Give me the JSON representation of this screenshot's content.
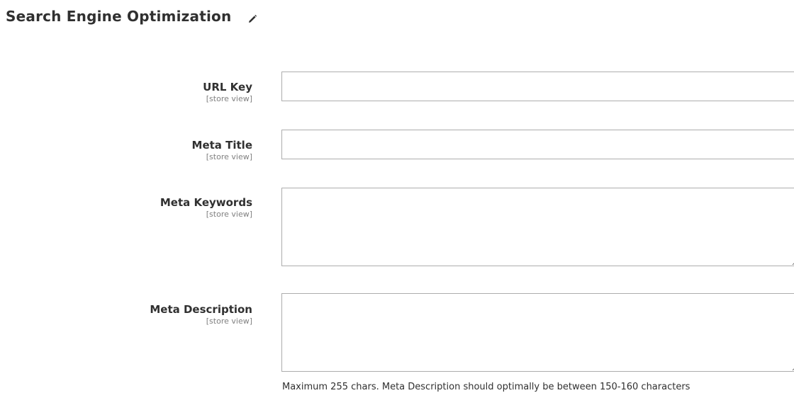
{
  "section": {
    "title": "Search Engine Optimization",
    "edit_icon": "pencil-icon"
  },
  "fields": {
    "url_key": {
      "label": "URL Key",
      "scope": "[store view]",
      "value": ""
    },
    "meta_title": {
      "label": "Meta Title",
      "scope": "[store view]",
      "value": ""
    },
    "meta_keywords": {
      "label": "Meta Keywords",
      "scope": "[store view]",
      "value": ""
    },
    "meta_description": {
      "label": "Meta Description",
      "scope": "[store view]",
      "value": "",
      "note": "Maximum 255 chars. Meta Description should optimally be between 150-160 characters"
    }
  }
}
